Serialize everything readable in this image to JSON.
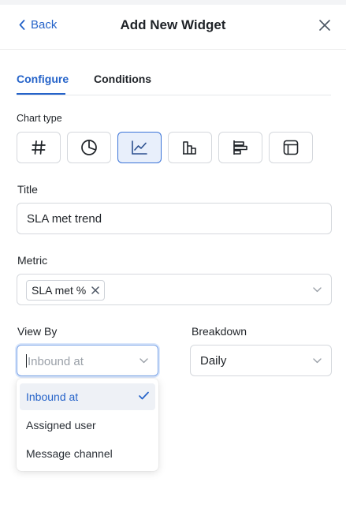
{
  "header": {
    "back_label": "Back",
    "title": "Add New Widget"
  },
  "tabs": [
    {
      "label": "Configure",
      "active": true
    },
    {
      "label": "Conditions",
      "active": false
    }
  ],
  "chart_type": {
    "label": "Chart type",
    "options": [
      "number-icon",
      "pie-icon",
      "line-chart-icon",
      "bar-chart-icon",
      "horizontal-bar-icon",
      "table-icon"
    ],
    "selected": "line-chart-icon"
  },
  "title_field": {
    "label": "Title",
    "value": "SLA met trend"
  },
  "metric": {
    "label": "Metric",
    "chip": "SLA met %"
  },
  "view_by": {
    "label": "View By",
    "placeholder": "Inbound at",
    "options": [
      "Inbound at",
      "Assigned user",
      "Message channel"
    ],
    "selected": "Inbound at"
  },
  "breakdown": {
    "label": "Breakdown",
    "value": "Daily"
  },
  "colors": {
    "accent": "#2563c9",
    "selected_bg": "#e8effb",
    "border": "#d5d8dd"
  }
}
